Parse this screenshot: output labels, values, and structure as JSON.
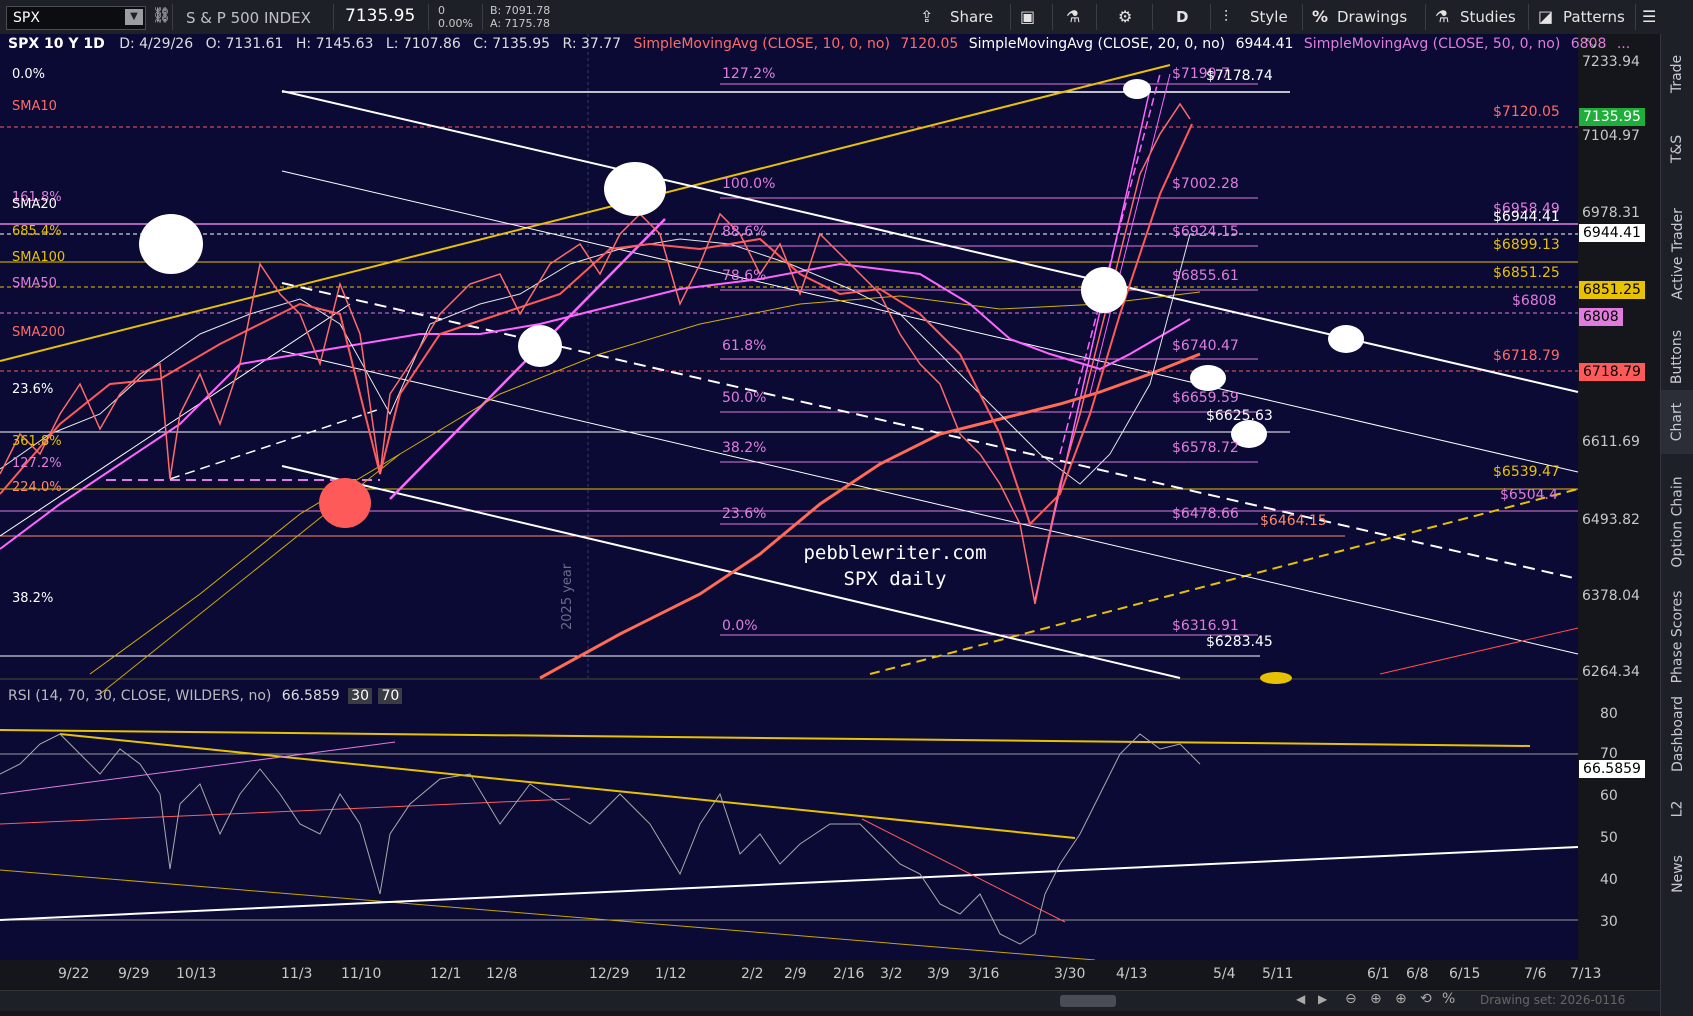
{
  "toolbar": {
    "symbol": "SPX",
    "name": "S & P 500 INDEX",
    "last": "7135.95",
    "change": "0",
    "change_pct": "0.00%",
    "bid": "B: 7091.78",
    "ask": "A: 7175.78",
    "share": "Share",
    "timeframe": "D",
    "style": "Style",
    "drawings": "Drawings",
    "studies": "Studies",
    "patterns": "Patterns"
  },
  "header": {
    "title": "SPX 10 Y 1D",
    "date": "D: 4/29/26",
    "open": "O: 7131.61",
    "high": "H: 7145.63",
    "low": "L: 7107.86",
    "close": "C: 7135.95",
    "range": "R: 37.77",
    "sma10": "SimpleMovingAvg (CLOSE, 10, 0, no)",
    "sma10_val": "7120.05",
    "sma20": "SimpleMovingAvg (CLOSE, 20, 0, no)",
    "sma20_val": "6944.41",
    "sma50": "SimpleMovingAvg (CLOSE, 50, 0, no)",
    "sma50_val": "6808",
    "more": "..."
  },
  "left_labels": [
    {
      "text": "0.0%",
      "color": "#ffffff"
    },
    {
      "text": "SMA10",
      "color": "#ff6b6b"
    },
    {
      "text": "161.8%",
      "color": "#e07cdd"
    },
    {
      "text": "SMA20",
      "color": "#ffffff"
    },
    {
      "text": "685.4%",
      "color": "#e8c200"
    },
    {
      "text": "SMA100",
      "color": "#e8c200"
    },
    {
      "text": "SMA50",
      "color": "#e07cdd"
    },
    {
      "text": "SMA200",
      "color": "#ff6b6b"
    },
    {
      "text": "23.6%",
      "color": "#ffffff"
    },
    {
      "text": "361.8%",
      "color": "#e8c200"
    },
    {
      "text": "127.2%",
      "color": "#e07cdd"
    },
    {
      "text": "224.0%",
      "color": "#ff8a6b"
    },
    {
      "text": "38.2%",
      "color": "#ffffff"
    }
  ],
  "fib_labels": [
    {
      "pct": "127.2%",
      "val": "$7199.7"
    },
    {
      "pct": "100.0%",
      "val": "$7002.28"
    },
    {
      "pct": "88.6%",
      "val": "$6924.15"
    },
    {
      "pct": "78.6%",
      "val": "$6855.61"
    },
    {
      "pct": "61.8%",
      "val": "$6740.47"
    },
    {
      "pct": "50.0%",
      "val": "$6659.59"
    },
    {
      "pct": "38.2%",
      "val": "$6578.72"
    },
    {
      "pct": "23.6%",
      "val": "$6478.66"
    },
    {
      "pct": "0.0%",
      "val": "$6316.91"
    }
  ],
  "right_labels": [
    {
      "text": "$7178.74",
      "color": "#ffffff"
    },
    {
      "text": "$7120.05",
      "color": "#ff6b6b"
    },
    {
      "text": "$6958.49",
      "color": "#e07cdd"
    },
    {
      "text": "$6944.41",
      "color": "#ffffff"
    },
    {
      "text": "$6899.13",
      "color": "#e8c200"
    },
    {
      "text": "$6851.25",
      "color": "#e8c200"
    },
    {
      "text": "$6808",
      "color": "#e07cdd"
    },
    {
      "text": "$6718.79",
      "color": "#ff6b6b"
    },
    {
      "text": "$6625.63",
      "color": "#ffffff"
    },
    {
      "text": "$6539.47",
      "color": "#e8c200"
    },
    {
      "text": "$6504.4",
      "color": "#e07cdd"
    },
    {
      "text": "$6464.15",
      "color": "#ff8a6b"
    },
    {
      "text": "$6283.45",
      "color": "#ffffff"
    }
  ],
  "price_axis": [
    "7233.94",
    "7104.97",
    "6978.31",
    "6611.69",
    "6493.82",
    "6378.04",
    "6264.34"
  ],
  "price_badges": [
    {
      "text": "7135.95",
      "bg": "#1fae3a",
      "fg": "#ffffff"
    },
    {
      "text": "6944.41",
      "bg": "#ffffff",
      "fg": "#000000"
    },
    {
      "text": "6851.25",
      "bg": "#e8c200",
      "fg": "#000000"
    },
    {
      "text": "6808",
      "bg": "#e07cdd",
      "fg": "#000000"
    },
    {
      "text": "6718.79",
      "bg": "#ff5a5a",
      "fg": "#000000"
    }
  ],
  "watermark": {
    "line1": "pebblewriter.com",
    "line2": "SPX daily",
    "year": "2025 year"
  },
  "rsi": {
    "label": "RSI (14, 70, 30, CLOSE, WILDERS, no)",
    "value": "66.5859",
    "os": "30",
    "ob": "70",
    "axis": [
      "80",
      "70",
      "60",
      "50",
      "40",
      "30"
    ],
    "badge": "66.5859"
  },
  "time_axis": [
    "9/22",
    "9/29",
    "10/13",
    "11/3",
    "11/10",
    "12/1",
    "12/8",
    "12/29",
    "1/12",
    "2/2",
    "2/9",
    "2/16",
    "3/2",
    "3/9",
    "3/16",
    "3/30",
    "4/13",
    "5/4",
    "5/11",
    "6/1",
    "6/8",
    "6/15",
    "7/6",
    "7/13"
  ],
  "sidebar": [
    "Trade",
    "T&S",
    "Active Trader",
    "Buttons",
    "Chart",
    "Option Chain",
    "Phase Scores",
    "Dashboard",
    "L2",
    "News"
  ],
  "status": "Drawing set: 2026-0116"
}
